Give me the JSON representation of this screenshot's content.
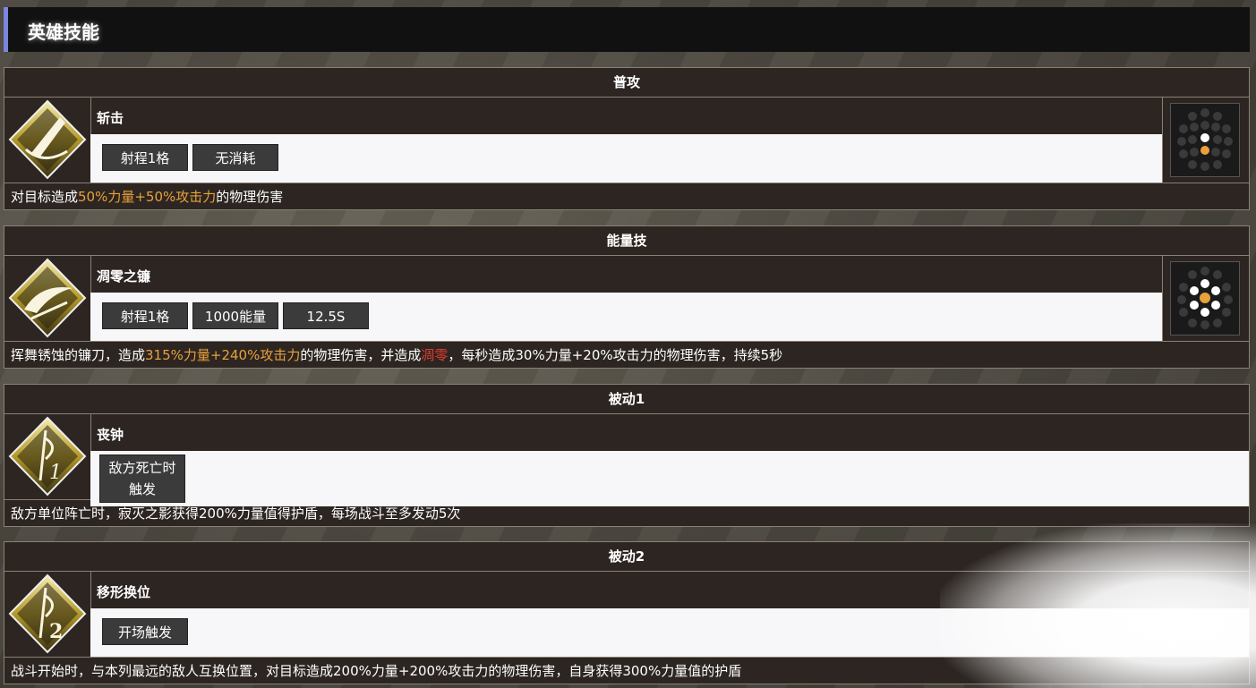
{
  "header": {
    "title": "英雄技能"
  },
  "skills": [
    {
      "category": "普攻",
      "name": "斩击",
      "tags": [
        "射程1格",
        "无消耗"
      ],
      "desc": [
        {
          "t": "对目标造成",
          "c": ""
        },
        {
          "t": "50%力量+50%攻击力",
          "c": "orange"
        },
        {
          "t": "的物理伤害",
          "c": ""
        }
      ],
      "icon": "slash-icon",
      "range_icon": "range-grid-icon"
    },
    {
      "category": "能量技",
      "name": "凋零之镰",
      "tags": [
        "射程1格",
        "1000能量",
        "12.5S"
      ],
      "desc": [
        {
          "t": "挥舞锈蚀的镰刀，造成",
          "c": ""
        },
        {
          "t": "315%力量+240%攻击力",
          "c": "orange"
        },
        {
          "t": "的物理伤害，并造成",
          "c": ""
        },
        {
          "t": "凋零",
          "c": "red"
        },
        {
          "t": "，每秒造成30%力量+20%攻击力的物理伤害，持续5秒",
          "c": ""
        }
      ],
      "icon": "scythe-icon",
      "range_icon": "range-grid-icon"
    },
    {
      "category": "被动1",
      "name": "丧钟",
      "tags": [
        "敌方死亡时\n触发"
      ],
      "desc": [
        {
          "t": "敌方单位阵亡时，寂灭之影获得200%力量值得护盾，每场战斗至多发动5次",
          "c": ""
        }
      ],
      "icon": "passive-1-icon"
    },
    {
      "category": "被动2",
      "name": "移形换位",
      "tags": [
        "开场触发"
      ],
      "desc": [
        {
          "t": "战斗开始时，与本列最远的敌人互换位置，对目标造成200%力量+200%攻击力的物理伤害，自身获得300%力量值的护盾",
          "c": ""
        }
      ],
      "icon": "passive-2-icon"
    }
  ],
  "colors": {
    "accent": "#7b86e0",
    "highlight_orange": "#e9a13b",
    "highlight_red": "#e23a31",
    "panel": "#2c2521"
  }
}
